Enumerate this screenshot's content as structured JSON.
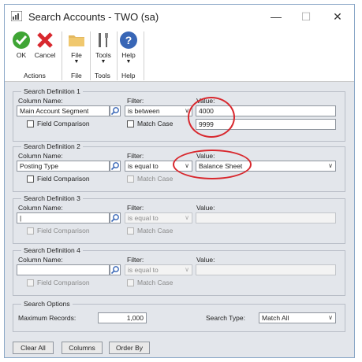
{
  "window": {
    "title": "Search Accounts  -  TWO (sa)"
  },
  "controls": {
    "minimize": "—",
    "maximize": "☐",
    "close": "✕"
  },
  "ribbon": {
    "ok": "OK",
    "cancel": "Cancel",
    "file": "File",
    "tools": "Tools",
    "help": "Help",
    "group_actions": "Actions",
    "group_file": "File",
    "group_tools": "Tools",
    "group_help": "Help",
    "arrow": "▼"
  },
  "labels": {
    "column_name": "Column Name:",
    "filter": "Filter:",
    "value": "Value:",
    "field_comparison": "Field Comparison",
    "match_case": "Match Case",
    "max_records": "Maximum Records:",
    "search_type": "Search Type:"
  },
  "defs": [
    {
      "title": "Search Definition 1",
      "column": "Main Account Segment",
      "filter": "is between",
      "value": "4000",
      "value2": "9999"
    },
    {
      "title": "Search Definition 2",
      "column": "Posting Type",
      "filter": "is equal to",
      "value": "Balance Sheet"
    },
    {
      "title": "Search Definition 3",
      "column": "|",
      "filter": "is equal to",
      "value": ""
    },
    {
      "title": "Search Definition 4",
      "column": "",
      "filter": "is equal to",
      "value": ""
    }
  ],
  "options": {
    "title": "Search Options",
    "max_records": "1,000",
    "search_type": "Match All"
  },
  "buttons": {
    "clear_all": "Clear All",
    "columns": "Columns",
    "order_by": "Order By"
  },
  "colors": {
    "highlight": "#d8282e",
    "panel": "#e3e6eb"
  }
}
